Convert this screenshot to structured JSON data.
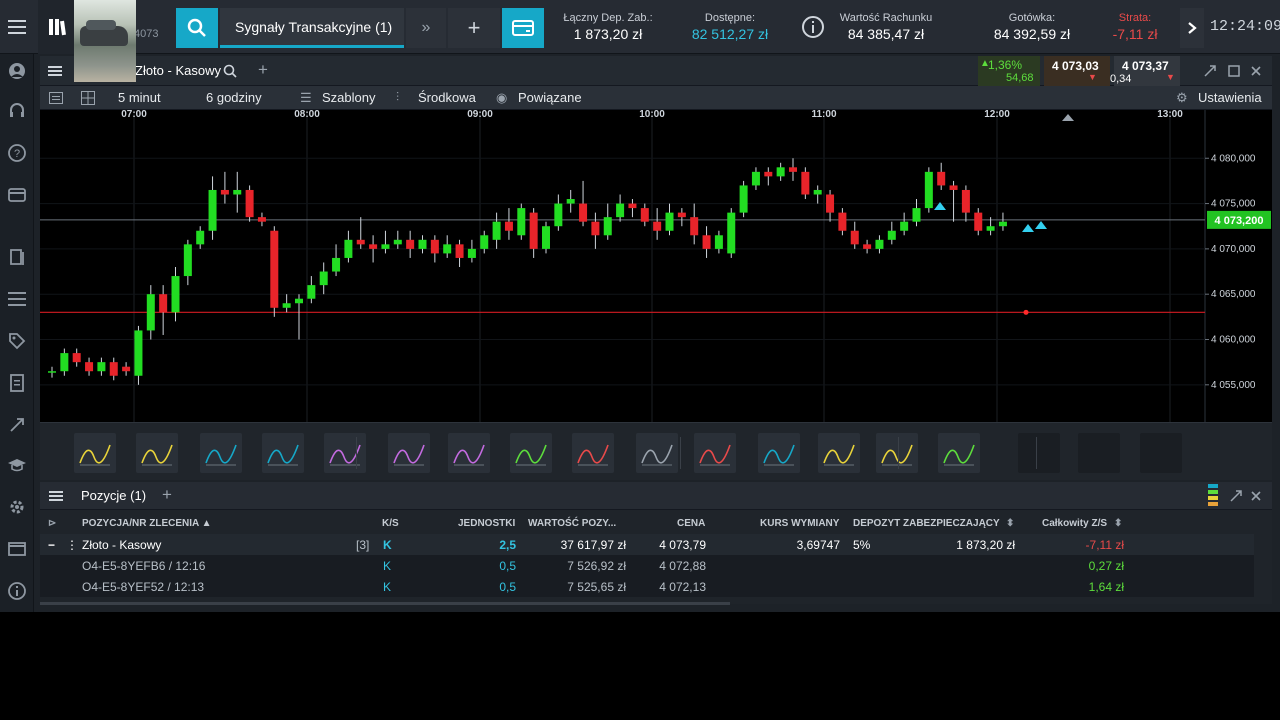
{
  "topbar": {
    "tabs_count": "4073",
    "signals_tab": "Sygnały Transakcyjne (1)",
    "more": "»",
    "add": "+",
    "stats": [
      {
        "label": "Łączny Dep. Zab.:",
        "value": "1 873,20 zł"
      },
      {
        "label": "Dostępne:",
        "value": "82 512,27 zł"
      },
      {
        "label": "Wartość Rachunku",
        "value": "84 385,47 zł"
      },
      {
        "label": "Gotówka:",
        "value": "84 392,59 zł"
      },
      {
        "label": "Strata:",
        "value": "-7,11 zł"
      }
    ],
    "time": "12:24:09"
  },
  "chart_panel": {
    "title": "Złoto - Kasowy",
    "add": "+",
    "change_pct": "1,36%",
    "change_abs": "54,68",
    "sell_price": "4 073,03",
    "buy_price": "4 073,37",
    "spread": "0,34",
    "toolbar": {
      "interval": "5 minut",
      "range": "6 godziny",
      "templates": "Szablony",
      "mid": "Środkowa",
      "linked": "Powiązane",
      "settings": "Ustawienia"
    }
  },
  "chart_data": {
    "type": "candlestick",
    "instrument": "Złoto - Kasowy",
    "interval": "5 minut",
    "time_labels": [
      "07:00",
      "08:00",
      "09:00",
      "10:00",
      "11:00",
      "12:00",
      "13:00"
    ],
    "y_ticks": [
      "4 080,000",
      "4 075,000",
      "4 070,000",
      "4 065,000",
      "4 060,000",
      "4 055,000"
    ],
    "ylim": [
      4052,
      4084
    ],
    "current_price_label": "4 073,200",
    "current_price": 4073.2,
    "red_line": 4063.0,
    "candles": [
      [
        4056.5,
        4056.5,
        4057.0,
        4055.8
      ],
      [
        4056.5,
        4058.5,
        4059.0,
        4056.0
      ],
      [
        4058.5,
        4057.5,
        4059.0,
        4057.0
      ],
      [
        4057.5,
        4056.5,
        4058.0,
        4056.0
      ],
      [
        4056.5,
        4057.5,
        4058.0,
        4056.0
      ],
      [
        4057.5,
        4056.0,
        4058.0,
        4055.5
      ],
      [
        4057.0,
        4056.5,
        4057.5,
        4056.0
      ],
      [
        4056.0,
        4061.0,
        4061.5,
        4055.0
      ],
      [
        4061.0,
        4065.0,
        4066.0,
        4060.0
      ],
      [
        4065.0,
        4063.0,
        4066.0,
        4060.5
      ],
      [
        4063.0,
        4067.0,
        4068.0,
        4062.0
      ],
      [
        4067.0,
        4070.5,
        4071.0,
        4066.0
      ],
      [
        4070.5,
        4072.0,
        4072.5,
        4070.0
      ],
      [
        4072.0,
        4076.5,
        4078.0,
        4071.0
      ],
      [
        4076.5,
        4076.0,
        4078.5,
        4075.0
      ],
      [
        4076.0,
        4076.5,
        4078.5,
        4074.0
      ],
      [
        4076.5,
        4073.5,
        4077.0,
        4073.0
      ],
      [
        4073.5,
        4073.0,
        4074.0,
        4072.5
      ],
      [
        4072.0,
        4063.5,
        4072.5,
        4062.5
      ],
      [
        4063.5,
        4064.0,
        4065.0,
        4063.0
      ],
      [
        4064.0,
        4064.5,
        4065.0,
        4060.0
      ],
      [
        4064.5,
        4066.0,
        4067.0,
        4064.0
      ],
      [
        4066.0,
        4067.5,
        4068.5,
        4065.0
      ],
      [
        4067.5,
        4069.0,
        4070.5,
        4067.0
      ],
      [
        4069.0,
        4071.0,
        4072.0,
        4068.5
      ],
      [
        4071.0,
        4070.5,
        4073.5,
        4070.0
      ],
      [
        4070.5,
        4070.0,
        4071.5,
        4068.5
      ],
      [
        4070.0,
        4070.5,
        4072.0,
        4069.5
      ],
      [
        4070.5,
        4071.0,
        4072.0,
        4070.0
      ],
      [
        4071.0,
        4070.0,
        4072.0,
        4069.0
      ],
      [
        4070.0,
        4071.0,
        4071.5,
        4069.5
      ],
      [
        4071.0,
        4069.5,
        4071.5,
        4068.5
      ],
      [
        4069.5,
        4070.5,
        4071.5,
        4069.0
      ],
      [
        4070.5,
        4069.0,
        4071.0,
        4068.0
      ],
      [
        4069.0,
        4070.0,
        4071.0,
        4068.5
      ],
      [
        4070.0,
        4071.5,
        4072.0,
        4069.5
      ],
      [
        4071.0,
        4073.0,
        4074.0,
        4070.0
      ],
      [
        4073.0,
        4072.0,
        4074.5,
        4071.0
      ],
      [
        4071.5,
        4074.5,
        4075.0,
        4071.0
      ],
      [
        4074.0,
        4070.0,
        4074.5,
        4069.0
      ],
      [
        4070.0,
        4072.5,
        4073.0,
        4069.5
      ],
      [
        4072.5,
        4075.0,
        4076.0,
        4072.0
      ],
      [
        4075.0,
        4075.5,
        4076.5,
        4074.0
      ],
      [
        4075.0,
        4073.0,
        4077.5,
        4072.5
      ],
      [
        4073.0,
        4071.5,
        4074.0,
        4070.0
      ],
      [
        4071.5,
        4073.5,
        4075.0,
        4071.0
      ],
      [
        4073.5,
        4075.0,
        4076.0,
        4073.0
      ],
      [
        4075.0,
        4074.5,
        4075.5,
        4073.5
      ],
      [
        4074.5,
        4073.0,
        4075.0,
        4072.5
      ],
      [
        4073.0,
        4072.0,
        4074.5,
        4071.0
      ],
      [
        4072.0,
        4074.0,
        4075.0,
        4071.5
      ],
      [
        4074.0,
        4073.5,
        4074.5,
        4072.5
      ],
      [
        4073.5,
        4071.5,
        4075.0,
        4070.5
      ],
      [
        4071.5,
        4070.0,
        4072.5,
        4069.0
      ],
      [
        4070.0,
        4071.5,
        4072.0,
        4069.5
      ],
      [
        4069.5,
        4074.0,
        4074.5,
        4069.0
      ],
      [
        4074.0,
        4077.0,
        4077.5,
        4073.5
      ],
      [
        4077.0,
        4078.5,
        4079.0,
        4076.5
      ],
      [
        4078.5,
        4078.0,
        4079.0,
        4077.0
      ],
      [
        4078.0,
        4079.0,
        4079.5,
        4077.5
      ],
      [
        4079.0,
        4078.5,
        4080.0,
        4077.5
      ],
      [
        4078.5,
        4076.0,
        4079.0,
        4075.5
      ],
      [
        4076.0,
        4076.5,
        4077.0,
        4075.0
      ],
      [
        4076.0,
        4074.0,
        4076.5,
        4073.0
      ],
      [
        4074.0,
        4072.0,
        4074.5,
        4071.5
      ],
      [
        4072.0,
        4070.5,
        4073.0,
        4070.0
      ],
      [
        4070.5,
        4070.0,
        4071.0,
        4069.5
      ],
      [
        4070.0,
        4071.0,
        4071.5,
        4069.5
      ],
      [
        4071.0,
        4072.0,
        4073.0,
        4070.5
      ],
      [
        4072.0,
        4073.0,
        4074.0,
        4071.5
      ],
      [
        4073.0,
        4074.5,
        4075.5,
        4072.5
      ],
      [
        4074.5,
        4078.5,
        4079.0,
        4074.0
      ],
      [
        4078.5,
        4077.0,
        4079.5,
        4076.5
      ],
      [
        4077.0,
        4076.5,
        4077.5,
        4073.0
      ],
      [
        4076.5,
        4074.0,
        4077.0,
        4073.0
      ],
      [
        4074.0,
        4072.0,
        4074.5,
        4071.5
      ],
      [
        4072.0,
        4072.5,
        4073.5,
        4071.5
      ],
      [
        4072.5,
        4073.0,
        4074.0,
        4072.0
      ]
    ]
  },
  "drawing_tools": [
    "trend-line-tool",
    "horizontal-line-tool",
    "price-range-tool",
    "fibonacci-tool",
    "indicator-oscillator-tool",
    "indicator-volume-tool",
    "indicator-bands-tool",
    "indicator-channel-tool",
    "indicator-ma-tool",
    "indicator-wave-tool",
    "indicator-histogram-tool",
    "indicator-rsi-tool",
    "pattern-triangle-tool",
    "pattern-wedge-tool",
    "crosshair-tool"
  ],
  "positions": {
    "title": "Pozycje (1)",
    "add": "+",
    "columns": [
      "POZYCJA/NR ZLECENIA ▲",
      "K/S",
      "JEDNOSTKI",
      "WARTOŚĆ POZY...",
      "CENA",
      "KURS WYMIANY",
      "DEPOZYT ZABEZPIECZAJĄCY",
      "Całkowity Z/S"
    ],
    "rows": [
      {
        "name": "Złoto - Kasowy",
        "count": "[3]",
        "side": "K",
        "units": "2,5",
        "value": "37 617,97 zł",
        "price": "4 073,79",
        "fx": "3,69747",
        "margin_pct": "5%",
        "margin": "1 873,20 zł",
        "pnl": "-7,11 zł",
        "pnl_color": "#e84a4a"
      },
      {
        "name": "O4-E5-8YEFB6 / 12:16",
        "count": "",
        "side": "K",
        "units": "0,5",
        "value": "7 526,92 zł",
        "price": "4 072,88",
        "fx": "",
        "margin_pct": "",
        "margin": "",
        "pnl": "0,27 zł",
        "pnl_color": "#5ddd3c"
      },
      {
        "name": "O4-E5-8YEF52 / 12:13",
        "count": "",
        "side": "K",
        "units": "0,5",
        "value": "7 525,65 zł",
        "price": "4 072,13",
        "fx": "",
        "margin_pct": "",
        "margin": "",
        "pnl": "1,64 zł",
        "pnl_color": "#5ddd3c"
      }
    ]
  },
  "colors": {
    "bull": "#22dd22",
    "bear": "#e8242a",
    "accent": "#16a8c8",
    "loss": "#e84a4a",
    "profit": "#5ddd3c"
  }
}
